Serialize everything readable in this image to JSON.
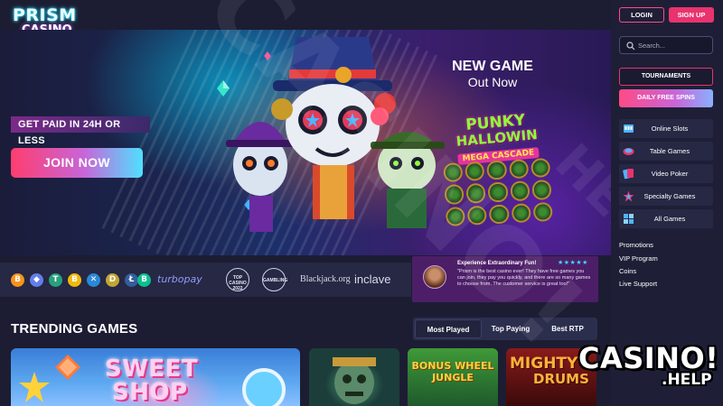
{
  "brand": {
    "logo_line1": "PRISM",
    "logo_line2": "CASINO"
  },
  "hero": {
    "tagline": "GET PAID IN 24H OR LESS",
    "join_label": "JOIN NOW",
    "new_game_title": "NEW GAME",
    "new_game_subtitle": "Out Now",
    "featured_game": {
      "line1": "PUNKY",
      "line2": "HALLOWIN",
      "line3": "MEGA CASCADE"
    }
  },
  "payments": {
    "coins": [
      {
        "letter": "B",
        "color": "#f7931a",
        "icon": "bitcoin-icon"
      },
      {
        "letter": "◆",
        "color": "#627eea",
        "icon": "ethereum-icon"
      },
      {
        "letter": "T",
        "color": "#26a17b",
        "icon": "tether-icon"
      },
      {
        "letter": "B",
        "color": "#f0b90b",
        "icon": "bnb-icon"
      },
      {
        "letter": "✕",
        "color": "#2a88d8",
        "icon": "xrp-icon"
      },
      {
        "letter": "D",
        "color": "#c2a633",
        "icon": "dogecoin-icon"
      },
      {
        "letter": "Ł",
        "color": "#345d9d",
        "icon": "litecoin-icon"
      },
      {
        "letter": "B",
        "color": "#0ac18e",
        "icon": "bitcoin-cash-icon"
      }
    ],
    "turbopay": "turbopay",
    "top_casino_badge": "TOP CASINO 2022",
    "gambling_badge": "GAMBLING",
    "blackjack": "Blackjack.org",
    "inclave": "inclave"
  },
  "testimonial": {
    "title": "Experience Extraordinary Fun!",
    "stars": "★★★★★",
    "body": "\"Prism is the best casino ever! They have free games you can join, they pay you quickly, and there are so many games to choose from. The customer service is great too!\""
  },
  "trending": {
    "title": "TRENDING GAMES",
    "tabs": [
      {
        "label": "Most Played",
        "active": true
      },
      {
        "label": "Top Paying",
        "active": false
      },
      {
        "label": "Best RTP",
        "active": false
      }
    ],
    "games": {
      "sweet_shop": {
        "line1": "SWEET",
        "line2": "SHOP"
      },
      "bonus_wheel": {
        "line1": "BONUS WHEEL",
        "line2": "JUNGLE"
      },
      "mighty_drums": {
        "line1": "MIGHTY",
        "line2": "DRUMS"
      }
    }
  },
  "sidebar": {
    "login_label": "LOGIN",
    "signup_label": "SIGN UP",
    "search_placeholder": "Search...",
    "tournaments_label": "TOURNAMENTS",
    "free_spins_label": "DAILY FREE SPINS",
    "nav": [
      {
        "label": "Online Slots",
        "icon": "slot-machine-icon"
      },
      {
        "label": "Table Games",
        "icon": "table-games-icon"
      },
      {
        "label": "Video Poker",
        "icon": "cards-icon"
      },
      {
        "label": "Specialty Games",
        "icon": "star-icon"
      },
      {
        "label": "All Games",
        "icon": "grid-icon"
      }
    ],
    "links": [
      "Promotions",
      "VIP Program",
      "Coins",
      "Live Support"
    ]
  },
  "watermark": {
    "main": "CASINO!",
    "sub": "HELP",
    "logo_main": "CASINO!",
    "logo_sub": ".HELP"
  },
  "colors": {
    "accent_pink": "#e8336e",
    "accent_cyan": "#4fe0ff",
    "sidebar_bg": "#1e1f37",
    "page_bg": "#1c1d33"
  }
}
